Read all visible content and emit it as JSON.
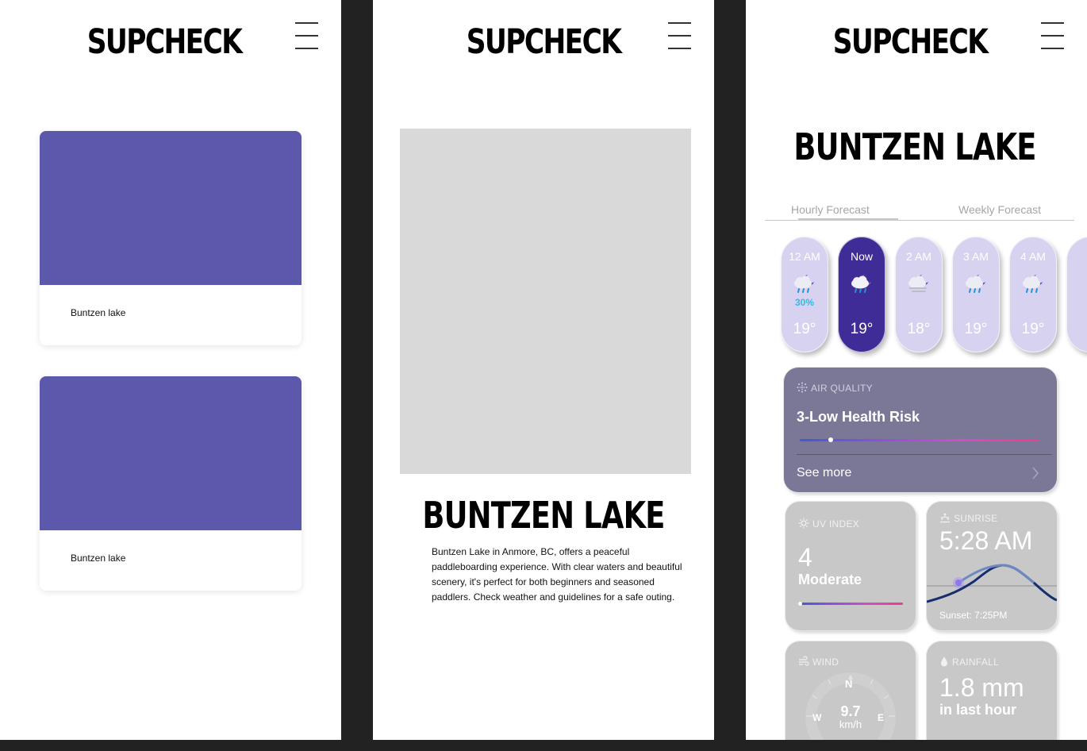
{
  "brand": "SUPCHECK",
  "screen_list": {
    "cards": [
      {
        "label": "Buntzen lake",
        "image_color": "#5c58ab"
      },
      {
        "label": "Buntzen lake",
        "image_color": "#5c58ab"
      }
    ]
  },
  "screen_detail": {
    "title": "BUNTZEN LAKE",
    "description": "Buntzen Lake in Anmore, BC, offers a peaceful paddleboarding experience. With clear waters and beautiful scenery, it's perfect for both beginners and seasoned paddlers. Check weather and guidelines for a safe outing."
  },
  "screen_forecast": {
    "title": "BUNTZEN LAKE",
    "tabs": {
      "hourly": "Hourly Forecast",
      "weekly": "Weekly Forecast"
    },
    "hours": [
      {
        "time": "12 AM",
        "pop": "30%",
        "temp": "19°",
        "icon": "cloud-rain-moon-icon"
      },
      {
        "time": "Now",
        "pop": "",
        "temp": "19°",
        "icon": "cloud-rain-moon-icon",
        "active": true
      },
      {
        "time": "2 AM",
        "pop": "",
        "temp": "18°",
        "icon": "cloud-fog-moon-icon"
      },
      {
        "time": "3 AM",
        "pop": "",
        "temp": "19°",
        "icon": "cloud-rain-moon-icon"
      },
      {
        "time": "4 AM",
        "pop": "",
        "temp": "19°",
        "icon": "cloud-rain-moon-icon"
      }
    ],
    "air_quality": {
      "heading": "AIR QUALITY",
      "value": "3-Low Health Risk",
      "level": 0.13,
      "more": "See more"
    },
    "uv": {
      "heading": "UV INDEX",
      "value": "4",
      "level_text": "Moderate",
      "level": 0.0
    },
    "sunrise": {
      "heading": "SUNRISE",
      "time": "5:28 AM",
      "sunset": "Sunset: 7:25PM"
    },
    "wind": {
      "heading": "WIND",
      "speed": "9.7",
      "unit": "km/h",
      "n": "N",
      "w": "W",
      "e": "E"
    },
    "rainfall": {
      "heading": "RAINFALL",
      "value": "1.8 mm",
      "sub": "in last hour"
    }
  }
}
